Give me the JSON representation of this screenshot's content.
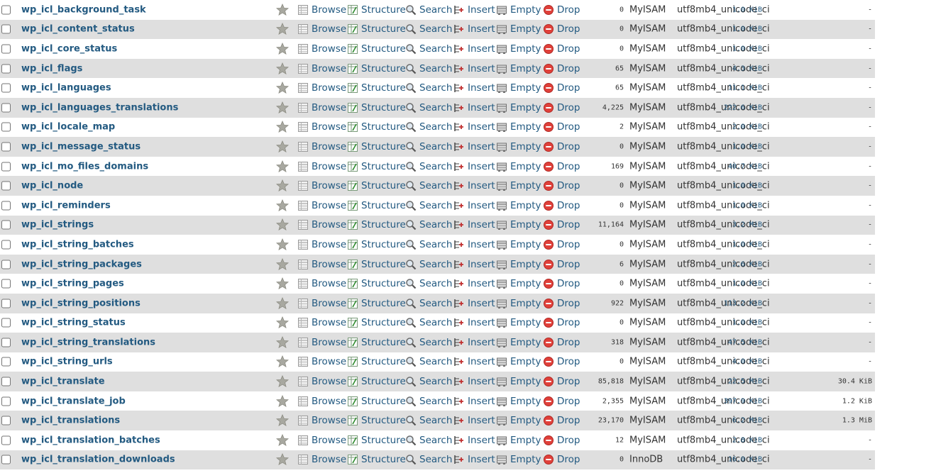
{
  "actions": {
    "browse": "Browse",
    "structure": "Structure",
    "search": "Search",
    "insert": "Insert",
    "empty": "Empty",
    "drop": "Drop"
  },
  "tables": [
    {
      "name": "wp_icl_background_task",
      "rows": "0",
      "engine": "MyISAM",
      "collation": "utf8mb4_unicode_ci",
      "size": "1.0 KiB",
      "overhead": "-"
    },
    {
      "name": "wp_icl_content_status",
      "rows": "0",
      "engine": "MyISAM",
      "collation": "utf8mb4_unicode_ci",
      "size": "1.0 KiB",
      "overhead": "-"
    },
    {
      "name": "wp_icl_core_status",
      "rows": "0",
      "engine": "MyISAM",
      "collation": "utf8mb4_unicode_ci",
      "size": "1.0 KiB",
      "overhead": "-"
    },
    {
      "name": "wp_icl_flags",
      "rows": "65",
      "engine": "MyISAM",
      "collation": "utf8mb4_unicode_ci",
      "size": "4.3 KiB",
      "overhead": "-"
    },
    {
      "name": "wp_icl_languages",
      "rows": "65",
      "engine": "MyISAM",
      "collation": "utf8mb4_unicode_ci",
      "size": "11.1 KiB",
      "overhead": "-"
    },
    {
      "name": "wp_icl_languages_translations",
      "rows": "4,225",
      "engine": "MyISAM",
      "collation": "utf8mb4_unicode_ci",
      "size": "222.6 KiB",
      "overhead": "-"
    },
    {
      "name": "wp_icl_locale_map",
      "rows": "2",
      "engine": "MyISAM",
      "collation": "utf8mb4_unicode_ci",
      "size": "2.0 KiB",
      "overhead": "-"
    },
    {
      "name": "wp_icl_message_status",
      "rows": "0",
      "engine": "MyISAM",
      "collation": "utf8mb4_unicode_ci",
      "size": "1.0 KiB",
      "overhead": "-"
    },
    {
      "name": "wp_icl_mo_files_domains",
      "rows": "169",
      "engine": "MyISAM",
      "collation": "utf8mb4_unicode_ci",
      "size": "40.7 KiB",
      "overhead": "-"
    },
    {
      "name": "wp_icl_node",
      "rows": "0",
      "engine": "MyISAM",
      "collation": "utf8mb4_unicode_ci",
      "size": "1.0 KiB",
      "overhead": "-"
    },
    {
      "name": "wp_icl_reminders",
      "rows": "0",
      "engine": "MyISAM",
      "collation": "utf8mb4_unicode_ci",
      "size": "1.0 KiB",
      "overhead": "-"
    },
    {
      "name": "wp_icl_strings",
      "rows": "11,164",
      "engine": "MyISAM",
      "collation": "utf8mb4_unicode_ci",
      "size": "3.2 MiB",
      "overhead": "-"
    },
    {
      "name": "wp_icl_string_batches",
      "rows": "0",
      "engine": "MyISAM",
      "collation": "utf8mb4_unicode_ci",
      "size": "1.0 KiB",
      "overhead": "-"
    },
    {
      "name": "wp_icl_string_packages",
      "rows": "6",
      "engine": "MyISAM",
      "collation": "utf8mb4_unicode_ci",
      "size": "2.6 KiB",
      "overhead": "-"
    },
    {
      "name": "wp_icl_string_pages",
      "rows": "0",
      "engine": "MyISAM",
      "collation": "utf8mb4_unicode_ci",
      "size": "1.0 KiB",
      "overhead": "-"
    },
    {
      "name": "wp_icl_string_positions",
      "rows": "922",
      "engine": "MyISAM",
      "collation": "utf8mb4_unicode_ci",
      "size": "113.2 KiB",
      "overhead": "-"
    },
    {
      "name": "wp_icl_string_status",
      "rows": "0",
      "engine": "MyISAM",
      "collation": "utf8mb4_unicode_ci",
      "size": "1.0 KiB",
      "overhead": "-"
    },
    {
      "name": "wp_icl_string_translations",
      "rows": "318",
      "engine": "MyISAM",
      "collation": "utf8mb4_unicode_ci",
      "size": "47.5 KiB",
      "overhead": "-"
    },
    {
      "name": "wp_icl_string_urls",
      "rows": "0",
      "engine": "MyISAM",
      "collation": "utf8mb4_unicode_ci",
      "size": "4.0 KiB",
      "overhead": "-"
    },
    {
      "name": "wp_icl_translate",
      "rows": "85,818",
      "engine": "MyISAM",
      "collation": "utf8mb4_unicode_ci",
      "size": "22.5 MiB",
      "overhead": "30.4 KiB"
    },
    {
      "name": "wp_icl_translate_job",
      "rows": "2,355",
      "engine": "MyISAM",
      "collation": "utf8mb4_unicode_ci",
      "size": "397.9 KiB",
      "overhead": "1.2 KiB"
    },
    {
      "name": "wp_icl_translations",
      "rows": "23,170",
      "engine": "MyISAM",
      "collation": "utf8mb4_unicode_ci",
      "size": "6.2 MiB",
      "overhead": "1.3 MiB"
    },
    {
      "name": "wp_icl_translation_batches",
      "rows": "12",
      "engine": "MyISAM",
      "collation": "utf8mb4_unicode_ci",
      "size": "2.8 KiB",
      "overhead": "-"
    },
    {
      "name": "wp_icl_translation_downloads",
      "rows": "0",
      "engine": "InnoDB",
      "collation": "utf8mb4_unicode_ci",
      "size": "16.0 KiB",
      "overhead": "-"
    }
  ]
}
